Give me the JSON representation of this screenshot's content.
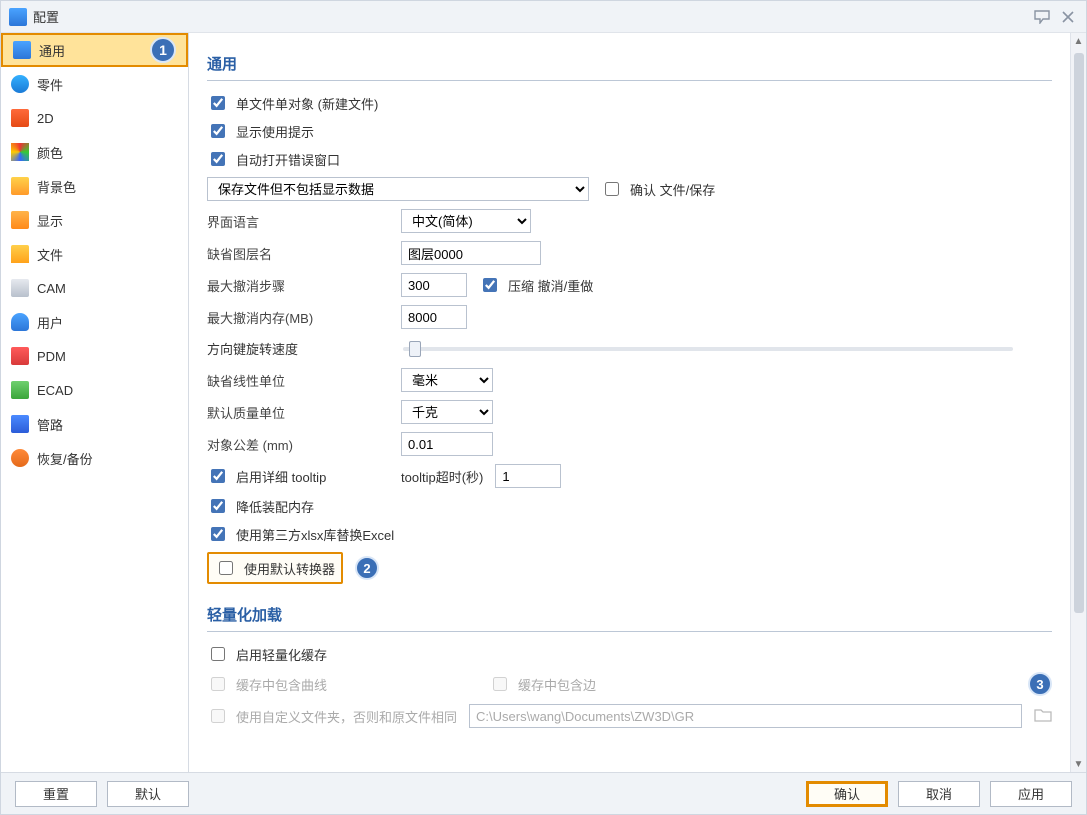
{
  "window": {
    "title": "配置"
  },
  "sidebar": {
    "items": [
      {
        "label": "通用"
      },
      {
        "label": "零件"
      },
      {
        "label": "2D"
      },
      {
        "label": "颜色"
      },
      {
        "label": "背景色"
      },
      {
        "label": "显示"
      },
      {
        "label": "文件"
      },
      {
        "label": "CAM"
      },
      {
        "label": "用户"
      },
      {
        "label": "PDM"
      },
      {
        "label": "ECAD"
      },
      {
        "label": "管路"
      },
      {
        "label": "恢复/备份"
      }
    ]
  },
  "callouts": {
    "one": "1",
    "two": "2",
    "three": "3"
  },
  "general": {
    "title": "通用",
    "chk_single_file": "单文件单对象 (新建文件)",
    "chk_show_hint": "显示使用提示",
    "chk_auto_err": "自动打开错误窗口",
    "save_mode": "保存文件但不包括显示数据",
    "chk_confirm_save": "确认 文件/保存",
    "lbl_lang": "界面语言",
    "lang_value": "中文(简体)",
    "lbl_layer": "缺省图层名",
    "layer_value": "图层0000",
    "lbl_undo_steps": "最大撤消步骤",
    "undo_steps_value": "300",
    "chk_compress_undo": "压缩 撤消/重做",
    "lbl_undo_mem": "最大撤消内存(MB)",
    "undo_mem_value": "8000",
    "lbl_rotate_speed": "方向键旋转速度",
    "lbl_linear_unit": "缺省线性单位",
    "linear_unit_value": "毫米",
    "lbl_mass_unit": "默认质量单位",
    "mass_unit_value": "千克",
    "lbl_tolerance": "对象公差  (mm)",
    "tolerance_value": "0.01",
    "chk_tooltip": "启用详细 tooltip",
    "lbl_tooltip_timeout": "tooltip超时(秒)",
    "tooltip_timeout_value": "1",
    "chk_reduce_mem": "降低装配内存",
    "chk_xlsx": "使用第三方xlsx库替换Excel",
    "chk_default_conv": "使用默认转换器"
  },
  "lightweight": {
    "title": "轻量化加载",
    "chk_enable": "启用轻量化缓存",
    "chk_curves": "缓存中包含曲线",
    "chk_edges": "缓存中包含边",
    "chk_custom_folder": "使用自定义文件夹，否则和原文件相同",
    "path_value": "C:\\Users\\wang\\Documents\\ZW3D\\GR"
  },
  "footer": {
    "reset": "重置",
    "defaults": "默认",
    "ok": "确认",
    "cancel": "取消",
    "apply": "应用"
  }
}
